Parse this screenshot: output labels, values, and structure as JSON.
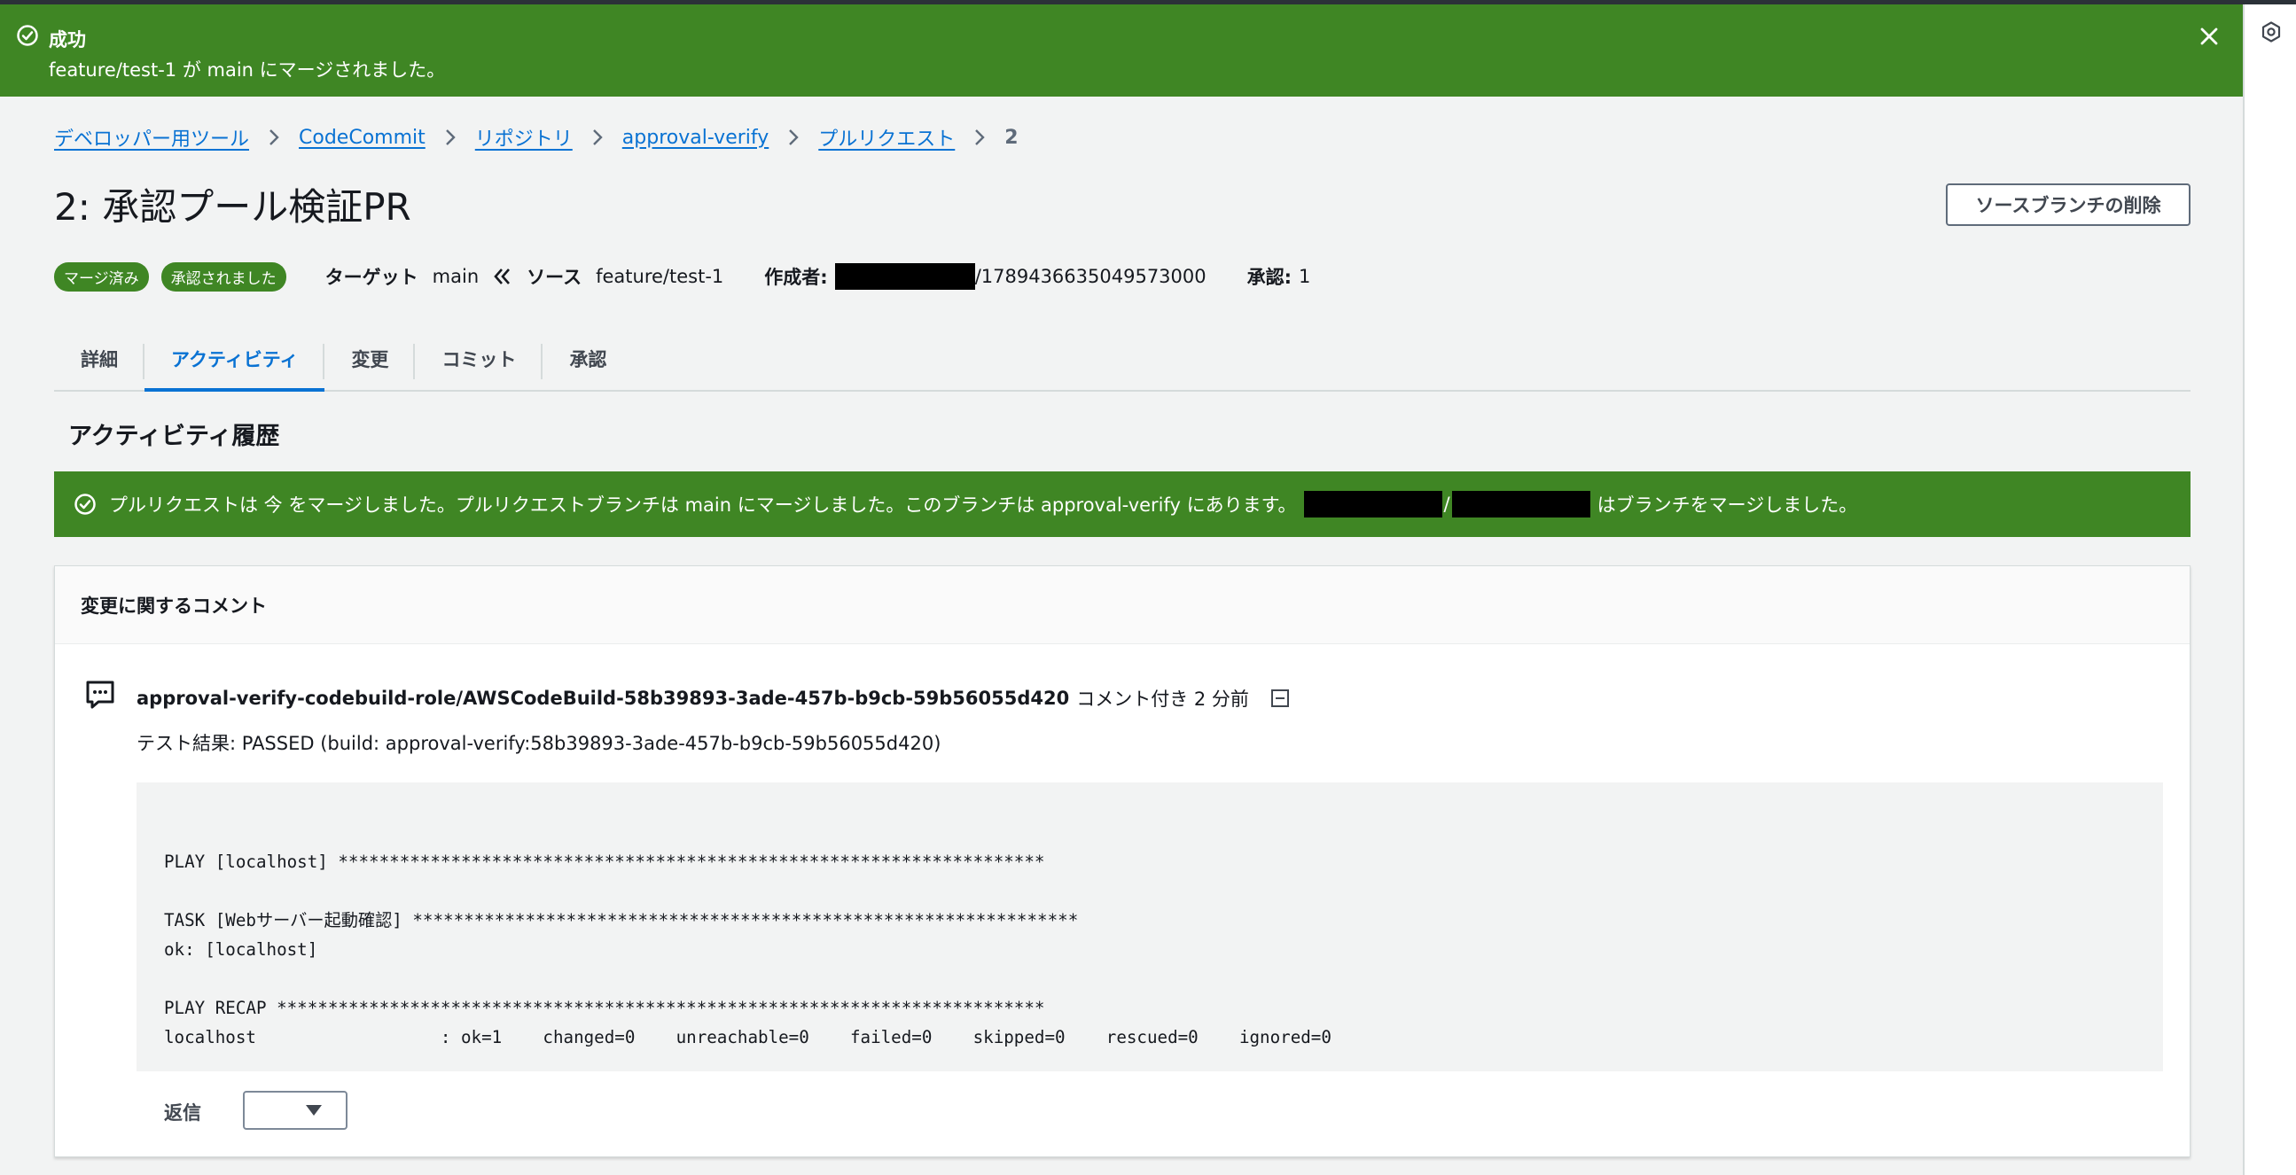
{
  "flash": {
    "title": "成功",
    "message": "feature/test-1 が main にマージされました。"
  },
  "breadcrumb": {
    "items": [
      "デベロッパー用ツール",
      "CodeCommit",
      "リポジトリ",
      "approval-verify",
      "プルリクエスト"
    ],
    "current": "2"
  },
  "page": {
    "title": "2: 承認プール検証PR",
    "delete_button": "ソースブランチの削除"
  },
  "meta": {
    "badges": [
      "マージ済み",
      "承認されました"
    ],
    "target_label": "ターゲット",
    "target_value": "main",
    "source_label": "ソース",
    "source_value": "feature/test-1",
    "author_label": "作成者:",
    "author_suffix": "/1789436635049573000",
    "approvals_label": "承認:",
    "approvals_value": "1"
  },
  "tabs": [
    "詳細",
    "アクティビティ",
    "変更",
    "コミット",
    "承認"
  ],
  "active_tab": 1,
  "activity": {
    "heading": "アクティビティ履歴",
    "banner_text": "プルリクエストは 今 をマージしました。プルリクエストブランチは main にマージしました。このブランチは approval-verify にあります。",
    "banner_sep": "/",
    "banner_suffix": "はブランチをマージしました。"
  },
  "comments": {
    "heading": "変更に関するコメント",
    "author": "approval-verify-codebuild-role/AWSCodeBuild-58b39893-3ade-457b-b9cb-59b56055d420",
    "when": "コメント付き 2 分前",
    "result": "テスト結果: PASSED (build: approval-verify:58b39893-3ade-457b-b9cb-59b56055d420)",
    "code_lines": [
      "",
      "PLAY [localhost] *********************************************************************",
      "",
      "TASK [Webサーバー起動確認] *****************************************************************",
      "ok: [localhost]",
      "",
      "PLAY RECAP ***************************************************************************",
      "localhost                  : ok=1    changed=0    unreachable=0    failed=0    skipped=0    rescued=0    ignored=0"
    ],
    "reply_label": "返信"
  },
  "colors": {
    "success_green": "#3f8624",
    "link_blue": "#0972d3",
    "page_bg": "#f2f3f3"
  }
}
